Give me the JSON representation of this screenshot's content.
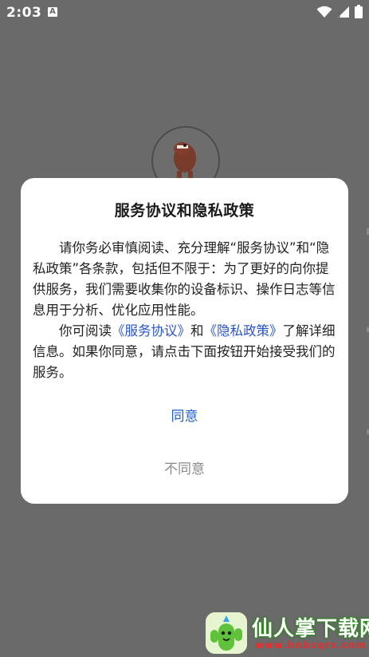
{
  "status_bar": {
    "time": "2:03",
    "notification_icon_letter": "A"
  },
  "dialog": {
    "title": "服务协议和隐私政策",
    "paragraph1": "请你务必审慎阅读、充分理解“服务协议”和“隐私政策”各条款，包括但不限于：为了更好的向你提供服务，我们需要收集你的设备标识、操作日志等信息用于分析、优化应用性能。",
    "paragraph2_prefix": "你可阅读",
    "service_link": "《服务协议》",
    "paragraph2_and": "和",
    "privacy_link": "《隐私政策》",
    "paragraph2_suffix": "了解详细信息。如果你同意，请点击下面按钮开始接受我们的服务。",
    "agree_label": "同意",
    "disagree_label": "不同意"
  },
  "watermark": {
    "title": "仙人掌下载网",
    "url": "www.hnbsqrx.com"
  },
  "colors": {
    "overlay": "#6a6a6a",
    "dialog_bg": "#ffffff",
    "agree": "#1f60c9",
    "link": "#2a54c6",
    "disagree": "#8a8a8a"
  },
  "icons": [
    "wifi-icon",
    "signal-icon",
    "battery-icon",
    "app-logo-icon",
    "cactus-icon"
  ]
}
